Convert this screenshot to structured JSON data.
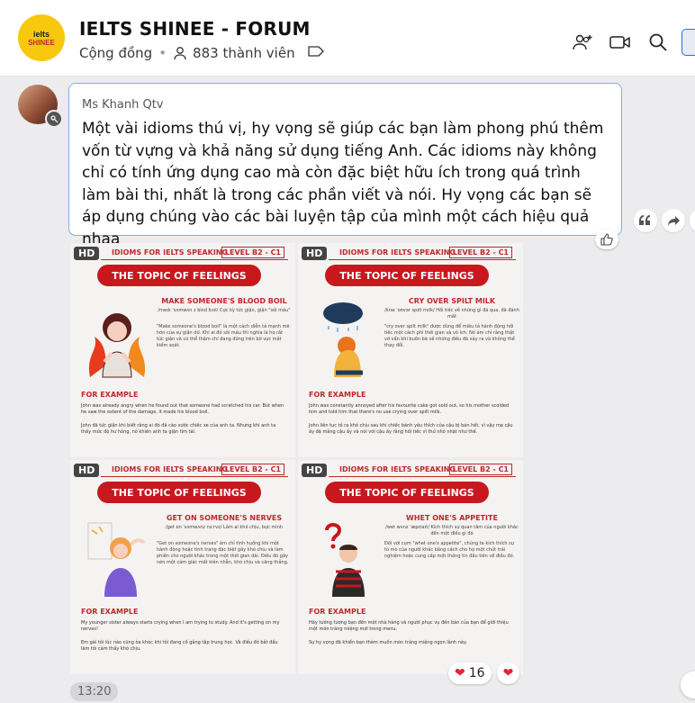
{
  "header": {
    "logo_line1": "ielts",
    "logo_line2": "SHINEE",
    "title": "IELTS SHINEE - FORUM",
    "community": "Cộng đồng",
    "members": "883 thành viên"
  },
  "message": {
    "sender": "Ms Khanh Qtv",
    "text": "Một vài idioms thú vị, hy vọng sẽ giúp các bạn làm phong phú thêm vốn từ vựng và khả năng sử dụng tiếng Anh. Các idioms này không chỉ có tính ứng dụng cao mà còn đặc biệt hữu ích trong quá trình làm bài thi, nhất là trong các phần viết và nói. Hy vọng các bạn sẽ áp dụng chúng vào các bài luyện tập của mình một cách hiệu quả nhaa"
  },
  "images": [
    {
      "hd": "HD",
      "header": "IDIOMS FOR IELTS SPEAKING",
      "level": "LEVEL B2 - C1",
      "topic": "THE TOPIC OF FEELINGS",
      "idiom": "MAKE SOMEONE'S BLOOD BOIL",
      "ipa": "/meɪk ˈsʌmwʌn z blʌd bɔɪl/ Cực kỳ tức giận, giận \"sôi máu\"",
      "desc": "\"Make someone's blood boil\" là một cách diễn tả mạnh mẽ hơn của sự giận dữ. Khi ai đó sôi máu thì nghĩa là họ rất tức giận và có thể thậm chí đang đứng trên bờ vực mất kiểm soát.",
      "for_example": "FOR EXAMPLE",
      "example": "John was already angry when he found out that someone had scratched his car. But when he saw the extent of the damage, it made his blood boil.",
      "translation": "John đã tức giận khi biết rằng ai đó đã cào xước chiếc xe của anh ta. Nhưng khi anh ta thấy mức độ hư hỏng, nó khiến anh ta giận tím tái."
    },
    {
      "hd": "HD",
      "header": "IDIOMS FOR IELTS SPEAKING",
      "level": "LEVEL B2 - C1",
      "topic": "THE TOPIC OF FEELINGS",
      "idiom": "CRY OVER SPILT MILK",
      "ipa": "/kraɪ ˈoʊvər spɪlt mɪlk/ Hối tiếc về những gì đã qua, đã đánh mất",
      "desc": "\"cry over spilt milk\" được dùng để miêu tả hành động hối tiếc một cách phí thời gian và vô ích. Nó ám chỉ rằng thật vớ vẩn khi buồn bã về những điều đã xảy ra và không thể thay đổi.",
      "for_example": "FOR EXAMPLE",
      "example": "John was constantly annoyed after his favourite cake got sold out, so his mother scolded him and told him that there's no use crying over spilt milk.",
      "translation": "John liên tục tỏ ra khó chịu sau khi chiếc bánh yêu thích của cậu bị bán hết, vì vậy mẹ cậu ấy đã mắng cậu ấy và nói với cậu ấy rằng hối tiếc vì thứ nhỏ nhặt như thế."
    },
    {
      "hd": "HD",
      "header": "IDIOMS FOR IELTS SPEAKING",
      "level": "LEVEL B2 - C1",
      "topic": "THE TOPIC OF FEELINGS",
      "idiom": "GET ON SOMEONE'S NERVES",
      "ipa": "/ɡet ɒn ˈsʌmwʌnz nɜːrvz/ Làm ai khó chịu, bực mình",
      "desc": "\"Get on someone's nerves\" ám chỉ tình huống khi một hành động hoặc tình trạng đặc biệt gây khó chịu và làm phiền cho người khác trong một thời gian dài. Điều đó gây nên một cảm giác mất kiên nhẫn, khó chịu và căng thẳng.",
      "for_example": "FOR EXAMPLE",
      "example": "My younger sister always starts crying when I am trying to study. And it's getting on my nerves!",
      "translation": "Em gái tôi lúc nào cũng òa khóc khi tôi đang cố gắng tập trung học. Và điều đó bắt đầu làm tôi cảm thấy khó chịu."
    },
    {
      "hd": "HD",
      "header": "IDIOMS FOR IELTS SPEAKING",
      "level": "LEVEL B2 - C1",
      "topic": "THE TOPIC OF FEELINGS",
      "idiom": "WHET ONE'S APPETITE",
      "ipa": "/wet wʌnz ˈæpɪtaɪt/ Kích thích sự quan tâm của người khác đến một điều gì đó",
      "desc": "Đối với cụm \"whet one's appetite\", chúng ta kích thích sự tò mò của người khác bằng cách cho họ một chút trải nghiệm hoặc cung cấp một thông tin đầu tiên về điều đó.",
      "for_example": "FOR EXAMPLE",
      "example": "Hãy tưởng tượng bạn đến một nhà hàng và người phục vụ đến bàn của bạn để giới thiệu một món tráng miệng mới trong menu.",
      "translation": "Sự hy vọng đã khiến bạn thèm muốn món tráng miệng ngon lành này."
    }
  ],
  "reactions": {
    "heart_count": "16"
  },
  "time": "13:20",
  "colors": {
    "accent_red": "#c8181d",
    "bubble_border": "#7aaef0",
    "logo_yellow": "#f7c80e"
  }
}
